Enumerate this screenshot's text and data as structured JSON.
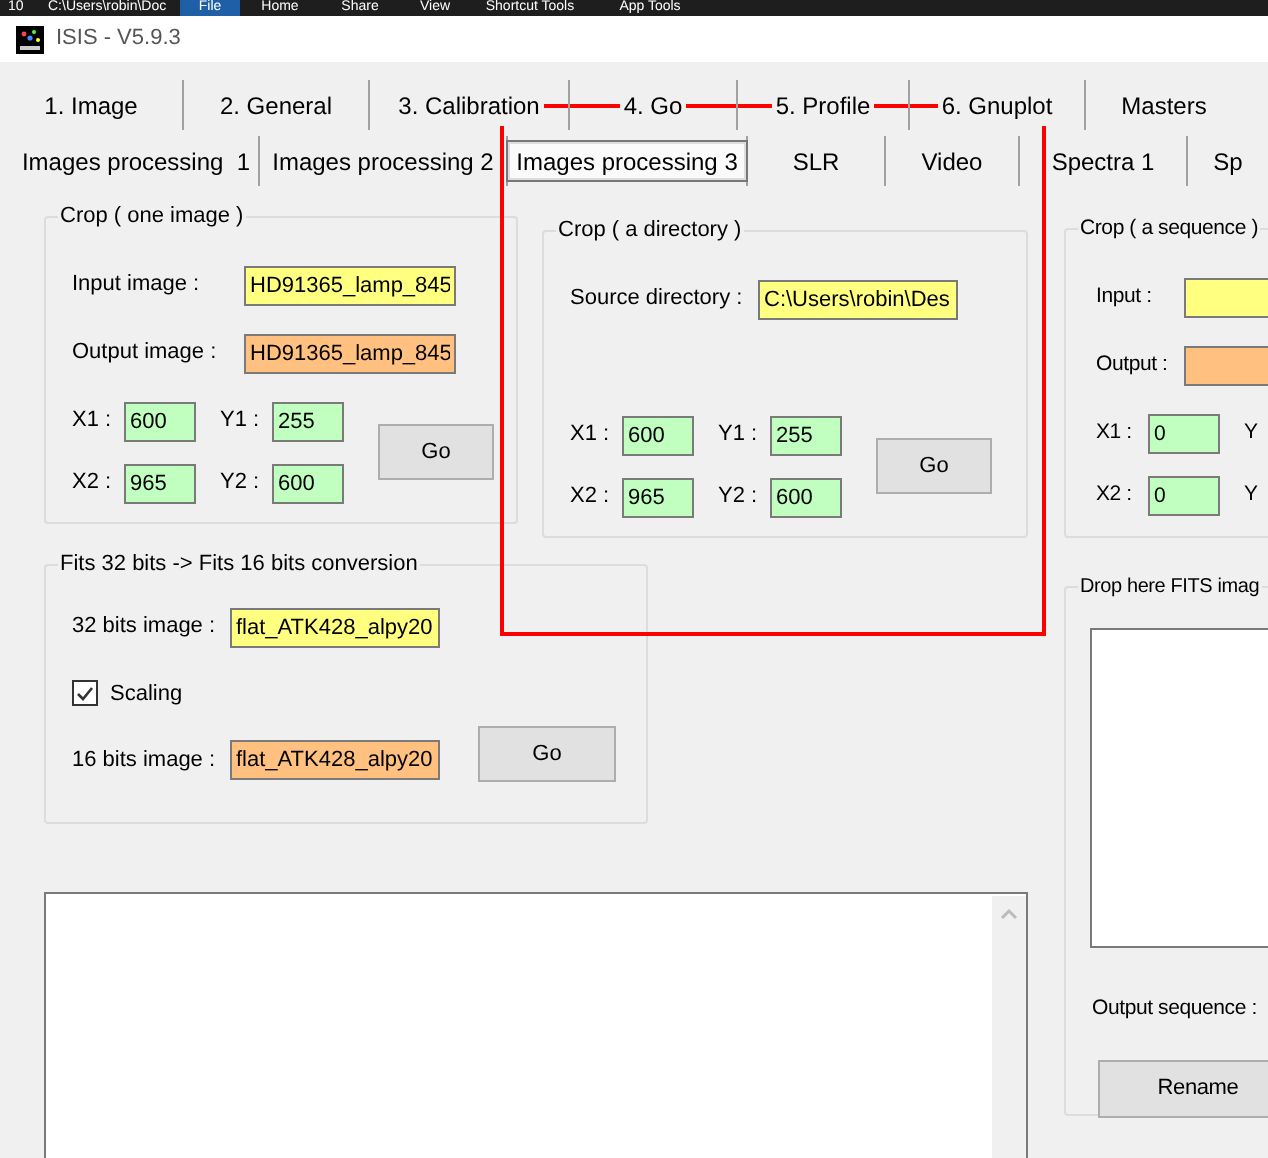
{
  "background_window": {
    "items": [
      {
        "label": "10",
        "selected": false
      },
      {
        "label": "C:\\Users\\robin\\Doc",
        "selected": false
      },
      {
        "label": "File",
        "selected": true
      },
      {
        "label": "Home",
        "selected": false
      },
      {
        "label": "Share",
        "selected": false
      },
      {
        "label": "View",
        "selected": false
      },
      {
        "label": "Shortcut Tools",
        "selected": false
      },
      {
        "label": "App Tools",
        "selected": false
      }
    ]
  },
  "window": {
    "title": "ISIS - V5.9.3"
  },
  "tabs": [
    {
      "label": "1. Image",
      "selected": false
    },
    {
      "label": "2. General",
      "selected": false
    },
    {
      "label": "3. Calibration",
      "selected": false
    },
    {
      "label": "4. Go",
      "selected": false
    },
    {
      "label": "5. Profile",
      "selected": false
    },
    {
      "label": "6. Gnuplot",
      "selected": false
    },
    {
      "label": "Masters",
      "selected": false
    }
  ],
  "subtabs": [
    {
      "label": "Images processing  1",
      "selected": false
    },
    {
      "label": "Images processing 2",
      "selected": false
    },
    {
      "label": "Images processing 3",
      "selected": true
    },
    {
      "label": "SLR",
      "selected": false
    },
    {
      "label": "Video",
      "selected": false
    },
    {
      "label": "Spectra 1",
      "selected": false
    },
    {
      "label": "Sp",
      "selected": false
    }
  ],
  "crop_groups": [
    {
      "title": "Crop ( one image )",
      "fields": [
        {
          "label": "Input image :",
          "value": "HD91365_lamp_845",
          "kind": "input"
        },
        {
          "label": "Output image :",
          "value": "HD91365_lamp_845",
          "kind": "output"
        }
      ],
      "coords": [
        {
          "label": "X1 :",
          "value": "600"
        },
        {
          "label": "Y1 :",
          "value": "255"
        },
        {
          "label": "X2 :",
          "value": "965"
        },
        {
          "label": "Y2 :",
          "value": "600"
        }
      ],
      "button": "Go"
    },
    {
      "title": "Crop ( a directory )",
      "fields": [
        {
          "label": "Source directory :",
          "value": "C:\\Users\\robin\\Des",
          "kind": "input"
        }
      ],
      "coords": [
        {
          "label": "X1 :",
          "value": "600"
        },
        {
          "label": "Y1 :",
          "value": "255"
        },
        {
          "label": "X2 :",
          "value": "965"
        },
        {
          "label": "Y2 :",
          "value": "600"
        }
      ],
      "button": "Go"
    },
    {
      "title": "Crop ( a sequence )",
      "fields": [
        {
          "label": "Input :",
          "kind": "input"
        },
        {
          "label": "Output :",
          "kind": "output"
        }
      ],
      "coords": [
        {
          "label": "X1 :",
          "value": "0"
        },
        {
          "label": "Y"
        },
        {
          "label": "X2 :",
          "value": "0"
        },
        {
          "label": "Y"
        }
      ]
    }
  ],
  "conversion": {
    "title": "Fits 32 bits -> Fits 16 bits conversion",
    "input": {
      "label": "32 bits image :",
      "value": "flat_ATK428_alpy20",
      "kind": "input"
    },
    "scaling": {
      "label": "Scaling",
      "checked": true
    },
    "output": {
      "label": "16 bits image :",
      "value": "flat_ATK428_alpy20",
      "kind": "output"
    },
    "button": "Go"
  },
  "drop_group": {
    "title": "Drop here FITS imag",
    "output_label": "Output sequence :",
    "button": "Rename"
  }
}
